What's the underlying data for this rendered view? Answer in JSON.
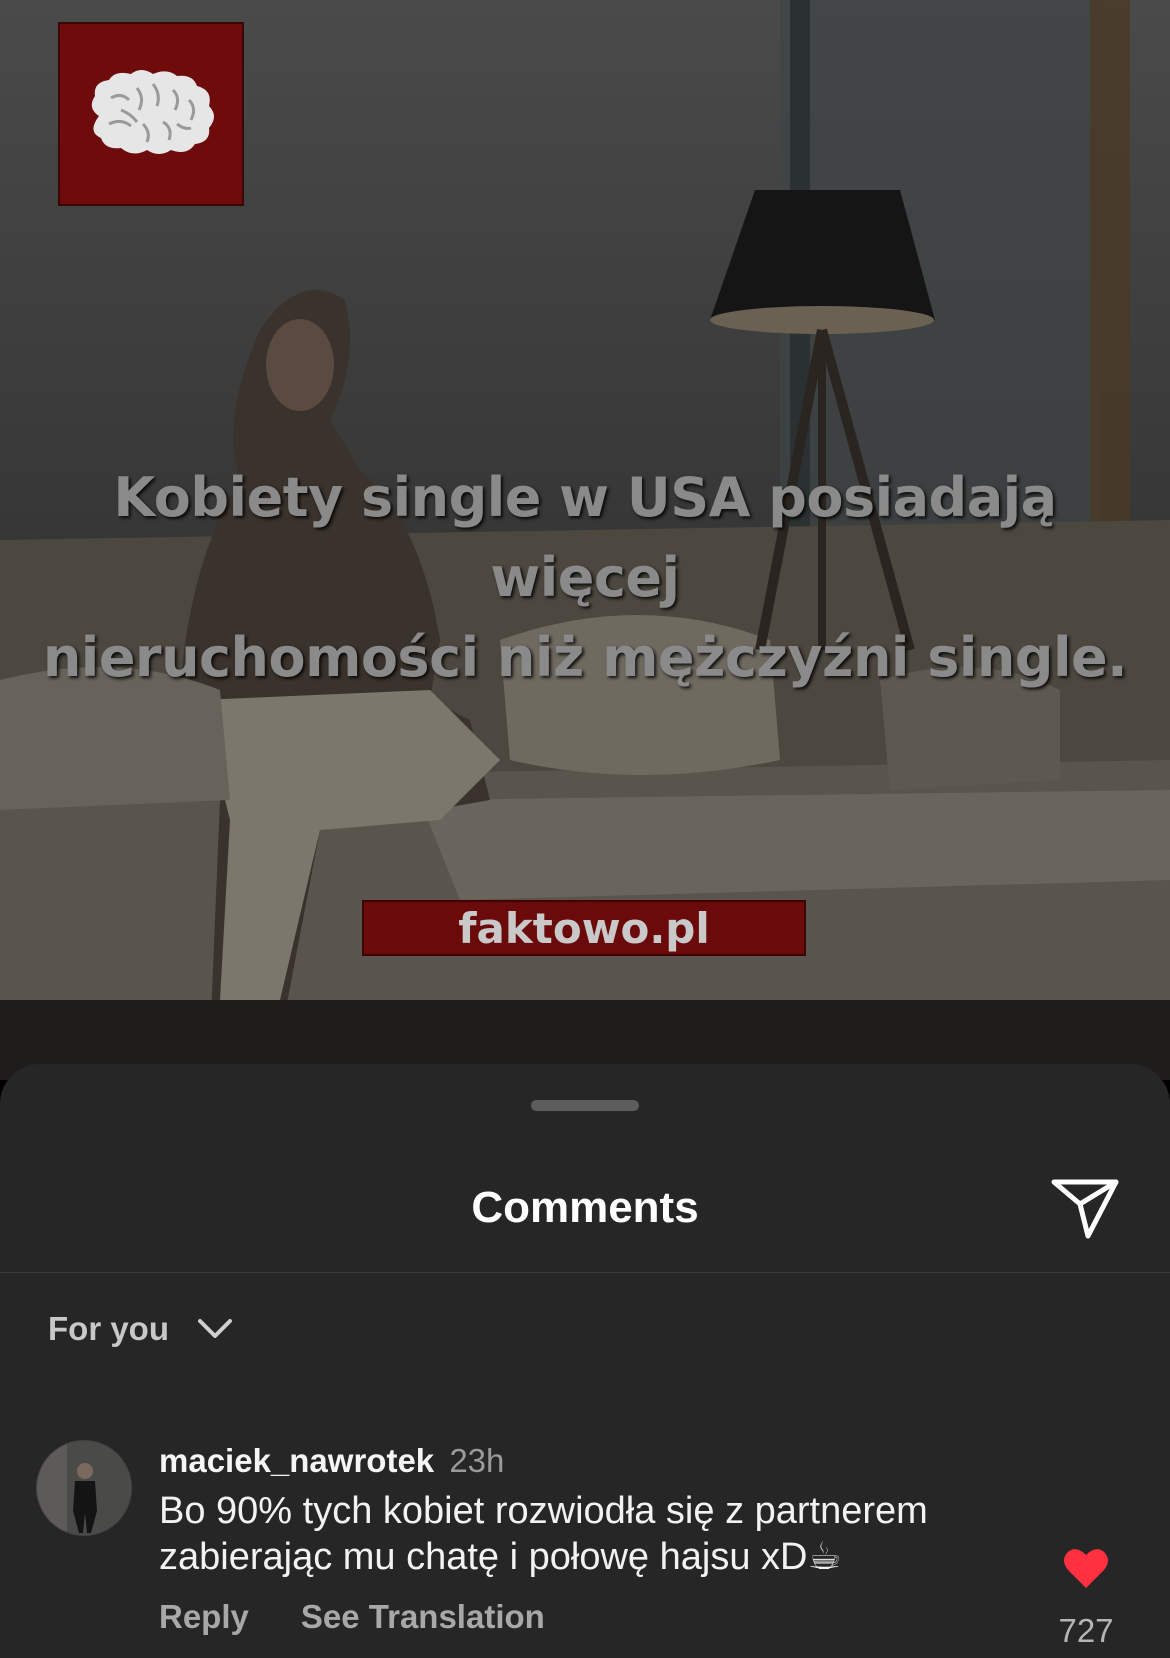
{
  "post": {
    "logo_icon": "brain-icon",
    "headline_line1": "Kobiety single w USA posiadają więcej",
    "headline_line2": "nieruchomości niż mężczyźni single.",
    "site": "faktowo.pl"
  },
  "comments_sheet": {
    "title": "Comments",
    "share_icon": "paper-plane-icon",
    "filter_label": "For you",
    "filter_icon": "chevron-down-icon"
  },
  "comments": [
    {
      "username": "maciek_nawrotek",
      "time": "23h",
      "text": "Bo 90% tych kobiet rozwiodła się z partnerem zabierając mu chatę i połowę hajsu xD☕",
      "reply_label": "Reply",
      "translate_label": "See Translation",
      "like_icon": "heart-filled-icon",
      "likes": "727",
      "liked": true
    }
  ],
  "colors": {
    "sheet_background": "#262626",
    "like_red": "#ff3040",
    "banner_red": "#6b0a0a"
  }
}
